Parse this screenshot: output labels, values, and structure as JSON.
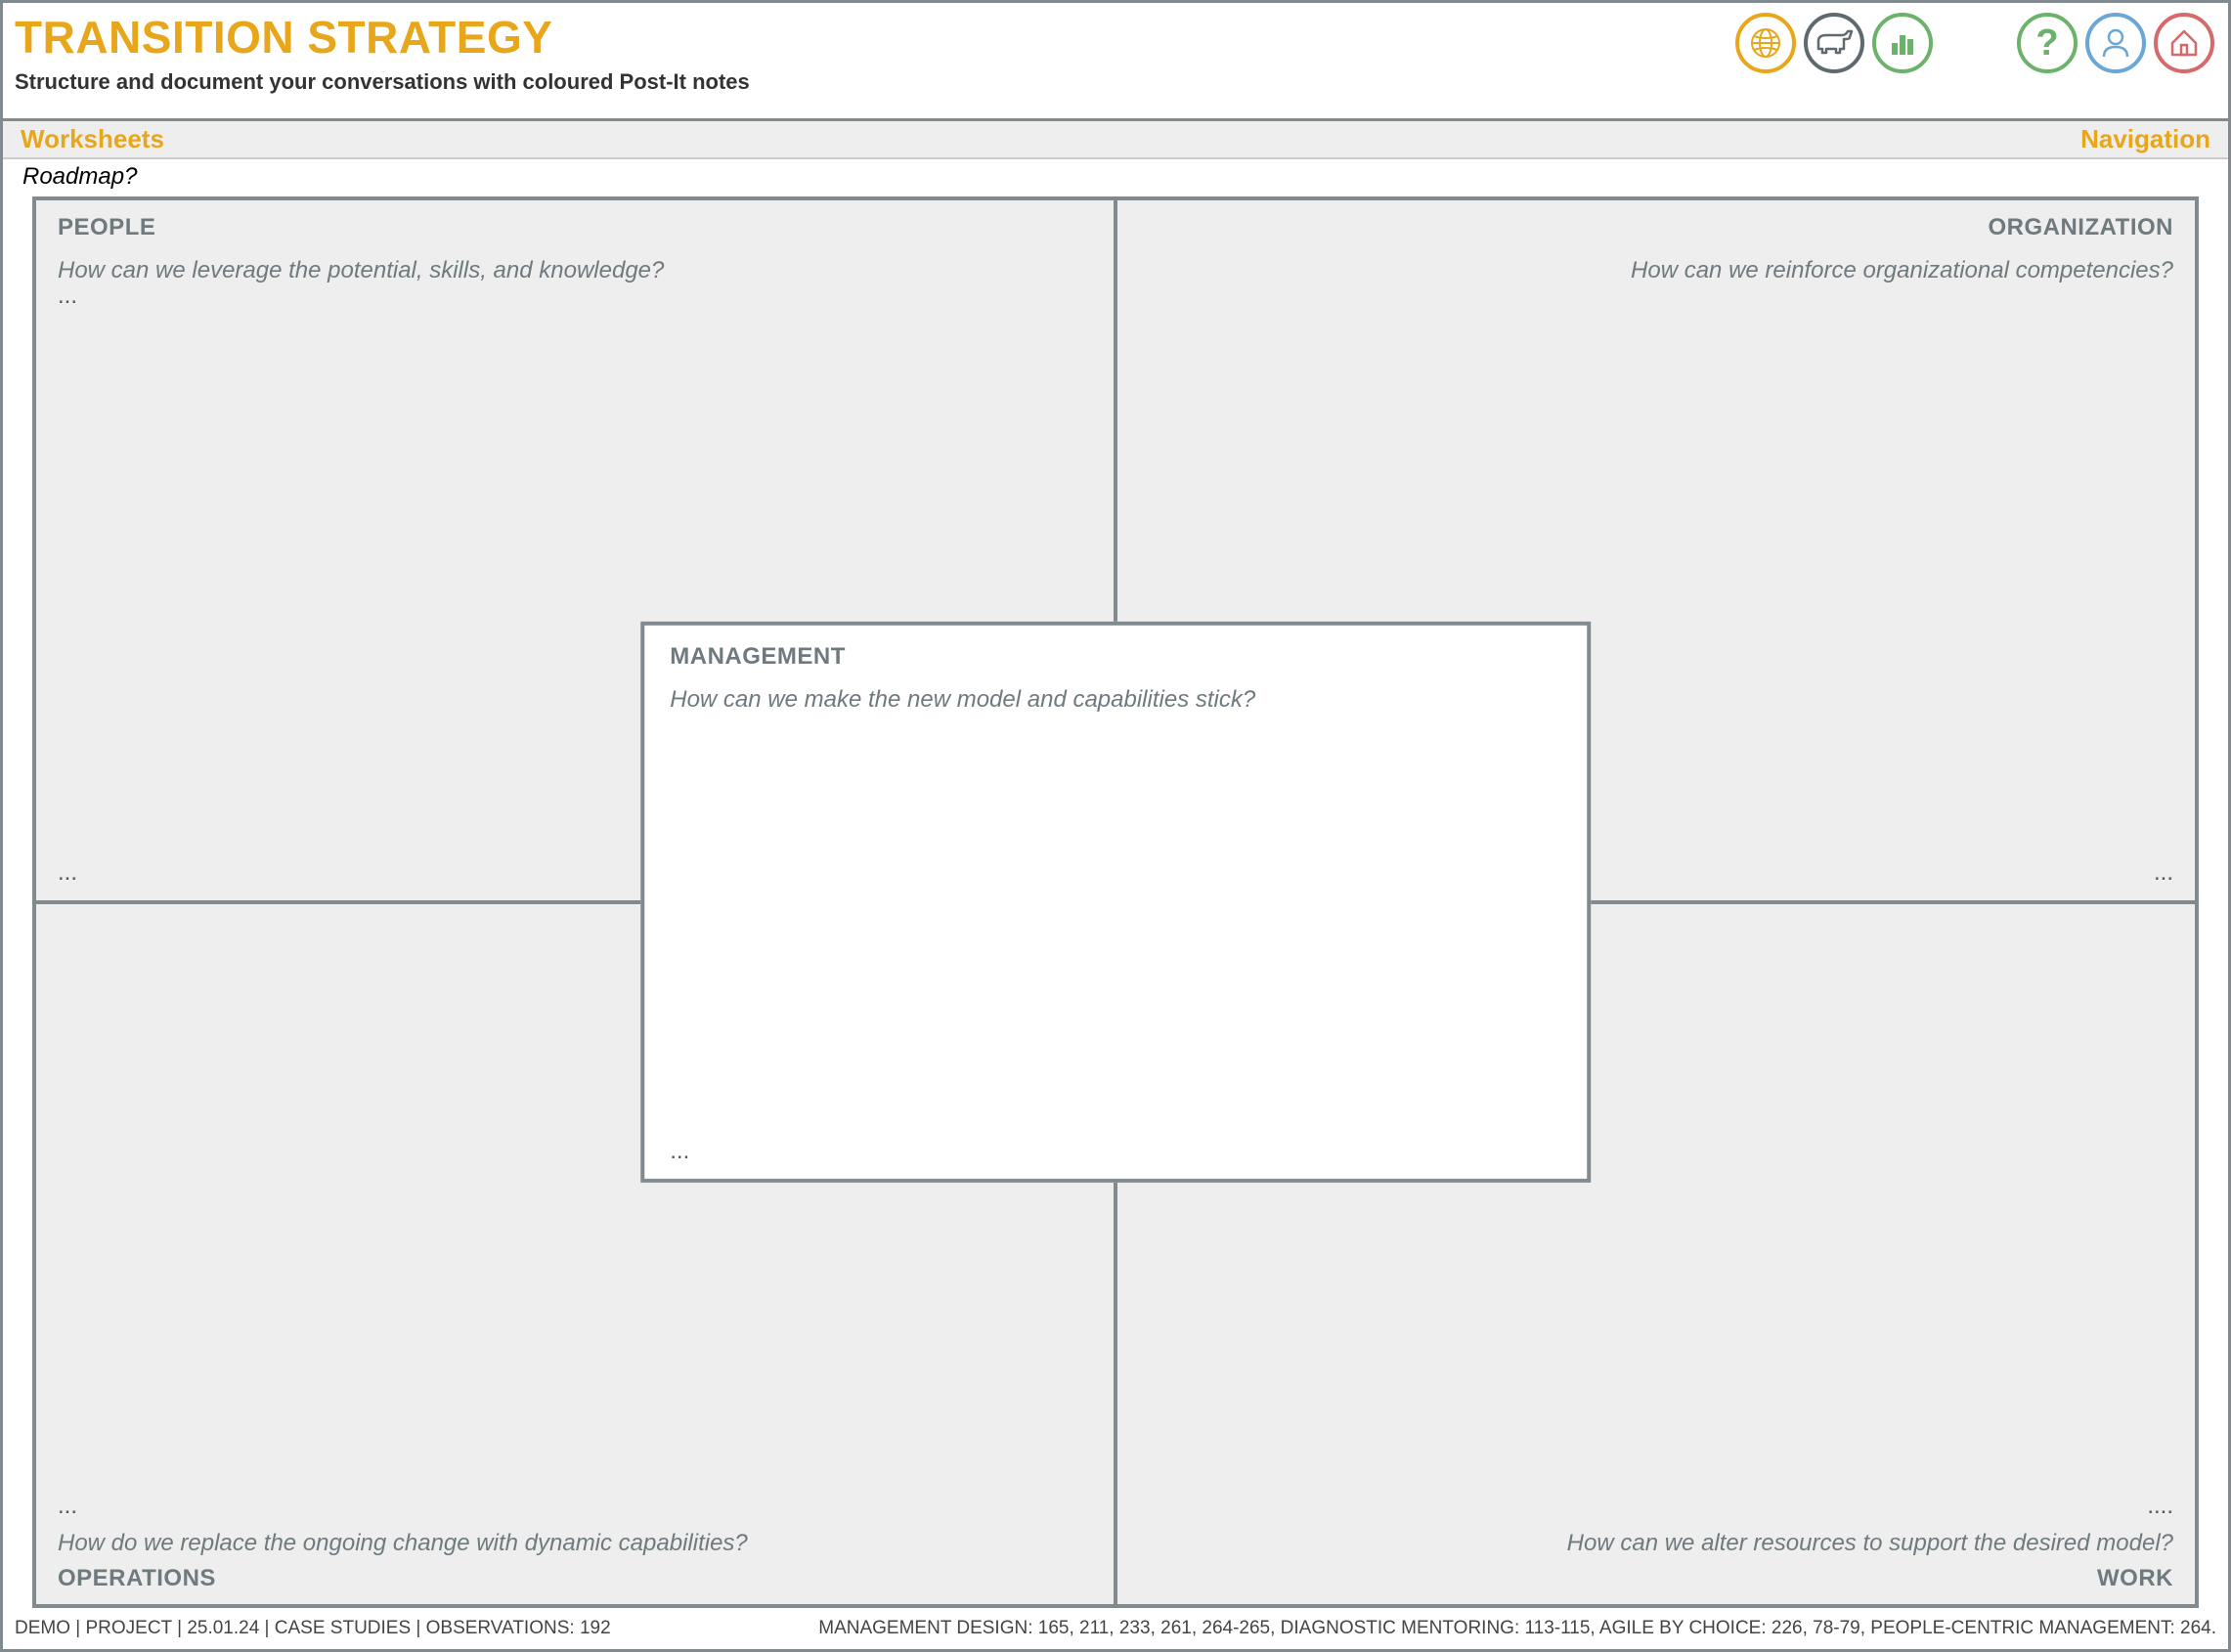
{
  "header": {
    "title": "TRANSITION STRATEGY",
    "subtitle": "Structure and document your conversations with coloured Post-It notes"
  },
  "bar": {
    "left": "Worksheets",
    "right": "Navigation"
  },
  "roadmap_label": "Roadmap?",
  "quadrants": {
    "people": {
      "heading": "PEOPLE",
      "prompt": "How can we leverage the potential, skills, and knowledge?",
      "dots_top": "...",
      "dots_bottom": "..."
    },
    "organization": {
      "heading": "ORGANIZATION",
      "prompt": "How can we reinforce organizational competencies?",
      "dots_bottom": "..."
    },
    "operations": {
      "heading": "OPERATIONS",
      "prompt": "How do we replace the ongoing change with dynamic capabilities?",
      "dots_bottom": "..."
    },
    "work": {
      "heading": "WORK",
      "prompt": "How can we alter resources to support the desired model?",
      "dots_bottom": "...."
    },
    "management": {
      "heading": "MANAGEMENT",
      "prompt": "How can we make the new model and capabilities stick?",
      "dots_bottom": "..."
    }
  },
  "footer": {
    "left": "DEMO  |  PROJECT  |  25.01.24  |  CASE STUDIES  |  OBSERVATIONS: 192",
    "right": "MANAGEMENT DESIGN: 165, 211, 233, 261, 264-265, DIAGNOSTIC MENTORING: 113-115, AGILE BY CHOICE: 226, 78-79, PEOPLE-CENTRIC MANAGEMENT: 264."
  },
  "icons": {
    "globe_label": "globe-icon",
    "dog_label": "dog-icon",
    "chart_label": "bar-chart-icon",
    "help_label": "help-icon",
    "person_label": "person-icon",
    "home_label": "home-icon"
  }
}
